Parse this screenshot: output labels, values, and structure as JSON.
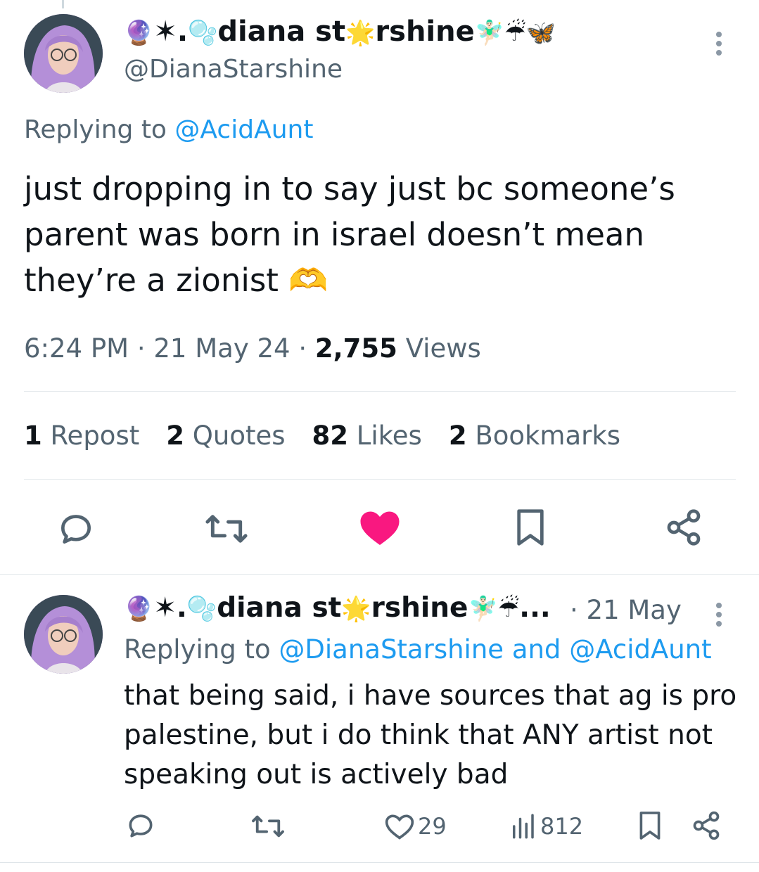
{
  "main_tweet": {
    "display_name": "🔮✶.🫧diana st🌟rshine🧚🏻‍♂️☔🦋",
    "name_parts": {
      "prefix_emoji": "🔮",
      "star": "✶.",
      "bubble": "🫧",
      "name_a": "diana st",
      "glow_star": "🌟",
      "name_b": "rshine",
      "suffix_emoji": "🧚🏻‍♂️☔🦋"
    },
    "handle": "@DianaStarshine",
    "replying_prefix": "Replying to",
    "replying_to": "@AcidAunt",
    "text_main": "just dropping in to say just bc someone’s parent was born in israel doesn’t mean they’re a zionist",
    "text_emoji": "🫶",
    "time": "6:24 PM",
    "date": "21 May 24",
    "views_count": "2,755",
    "views_label": "Views",
    "stats": {
      "reposts_count": "1",
      "reposts_label": "Repost",
      "quotes_count": "2",
      "quotes_label": "Quotes",
      "likes_count": "82",
      "likes_label": "Likes",
      "bookmarks_count": "2",
      "bookmarks_label": "Bookmarks"
    },
    "liked": true,
    "like_color": "#f91880"
  },
  "reply_tweet": {
    "name_parts": {
      "prefix_emoji": "🔮",
      "star": "✶.",
      "bubble": "🫧",
      "name_a": "diana st",
      "glow_star": "🌟",
      "name_b": "rshine",
      "suffix_emoji": "🧚🏻‍♂️☔",
      "ellipsis": "..."
    },
    "date": "· 21 May",
    "replying_prefix": "Replying to",
    "replying_to_a": "@DianaStarshine",
    "replying_and": "and",
    "replying_to_b": "@AcidAunt",
    "text": "that being said, i have sources that ag is pro palestine, but i do think that ANY artist not speaking out is actively bad",
    "likes": "29",
    "views": "812"
  },
  "icons": [
    "reply-icon",
    "repost-icon",
    "like-icon",
    "bookmark-icon",
    "share-icon",
    "views-icon",
    "more-icon"
  ],
  "colors": {
    "link": "#1d9bf0",
    "secondary": "#536471",
    "text": "#0f1419"
  }
}
